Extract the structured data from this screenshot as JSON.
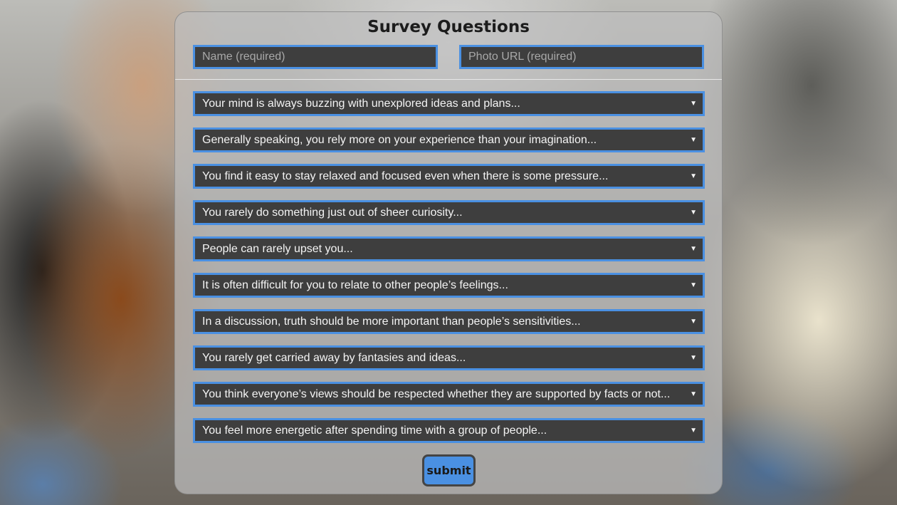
{
  "form": {
    "title": "Survey Questions",
    "name_placeholder": "Name (required)",
    "photo_placeholder": "Photo URL (required)",
    "submit_label": "submit",
    "caret_glyph": "▼"
  },
  "questions": [
    "Your mind is always buzzing with unexplored ideas and plans...",
    "Generally speaking, you rely more on your experience than your imagination...",
    "You find it easy to stay relaxed and focused even when there is some pressure...",
    "You rarely do something just out of sheer curiosity...",
    "People can rarely upset you...",
    "It is often difficult for you to relate to other people’s feelings...",
    "In a discussion, truth should be more important than people’s sensitivities...",
    "You rarely get carried away by fantasies and ideas...",
    "You think everyone’s views should be respected whether they are supported by facts or not...",
    "You feel more energetic after spending time with a group of people..."
  ],
  "colors": {
    "accent": "#4a90e2",
    "field_bg": "#3e3e3e",
    "panel_bg": "rgba(190,190,190,0.72)"
  }
}
